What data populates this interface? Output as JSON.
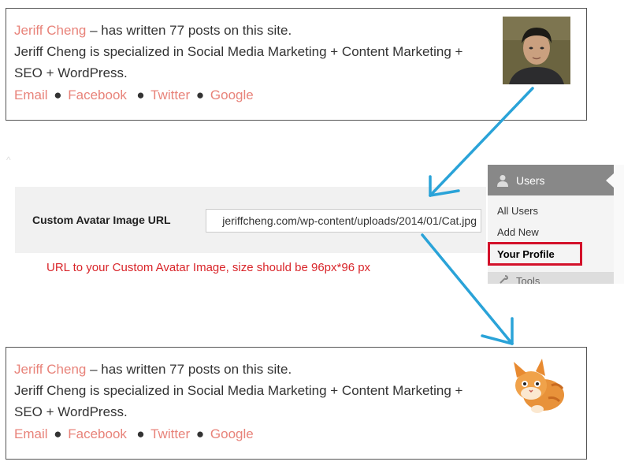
{
  "author_box_top": {
    "author_name": "Jeriff Cheng",
    "posts_text": " – has written 77 posts on this site.",
    "bio": "Jeriff Cheng is specialized in Social Media Marketing + Content Marketing + SEO + WordPress.",
    "links": {
      "email": "Email",
      "facebook": "Facebook",
      "twitter": "Twitter",
      "google": "Google"
    },
    "separator": "●"
  },
  "settings": {
    "label": "Custom Avatar Image URL",
    "input_value": "jeriffcheng.com/wp-content/uploads/2014/01/Cat.jpg",
    "help": "URL to your Custom Avatar Image, size should be 96px*96 px"
  },
  "wp_menu": {
    "section": "Users",
    "items": [
      {
        "label": "All Users"
      },
      {
        "label": "Add New"
      },
      {
        "label": "Your Profile"
      }
    ],
    "next_section": "Tools"
  },
  "author_box_bottom": {
    "author_name": "Jeriff Cheng",
    "posts_text": " – has written 77 posts on this site.",
    "bio": "Jeriff Cheng is specialized in Social Media Marketing + Content Marketing + SEO + WordPress.",
    "links": {
      "email": "Email",
      "facebook": "Facebook",
      "twitter": "Twitter",
      "google": "Google"
    },
    "separator": "●"
  },
  "colors": {
    "link": "#e8837a",
    "help_text": "#d9252a",
    "highlight": "#d3112a",
    "arrow": "#2aa3d8",
    "menu_head": "#888888"
  },
  "icons": {
    "users": "person-icon",
    "tools": "wrench-icon",
    "arrow": "arrow-icon"
  }
}
